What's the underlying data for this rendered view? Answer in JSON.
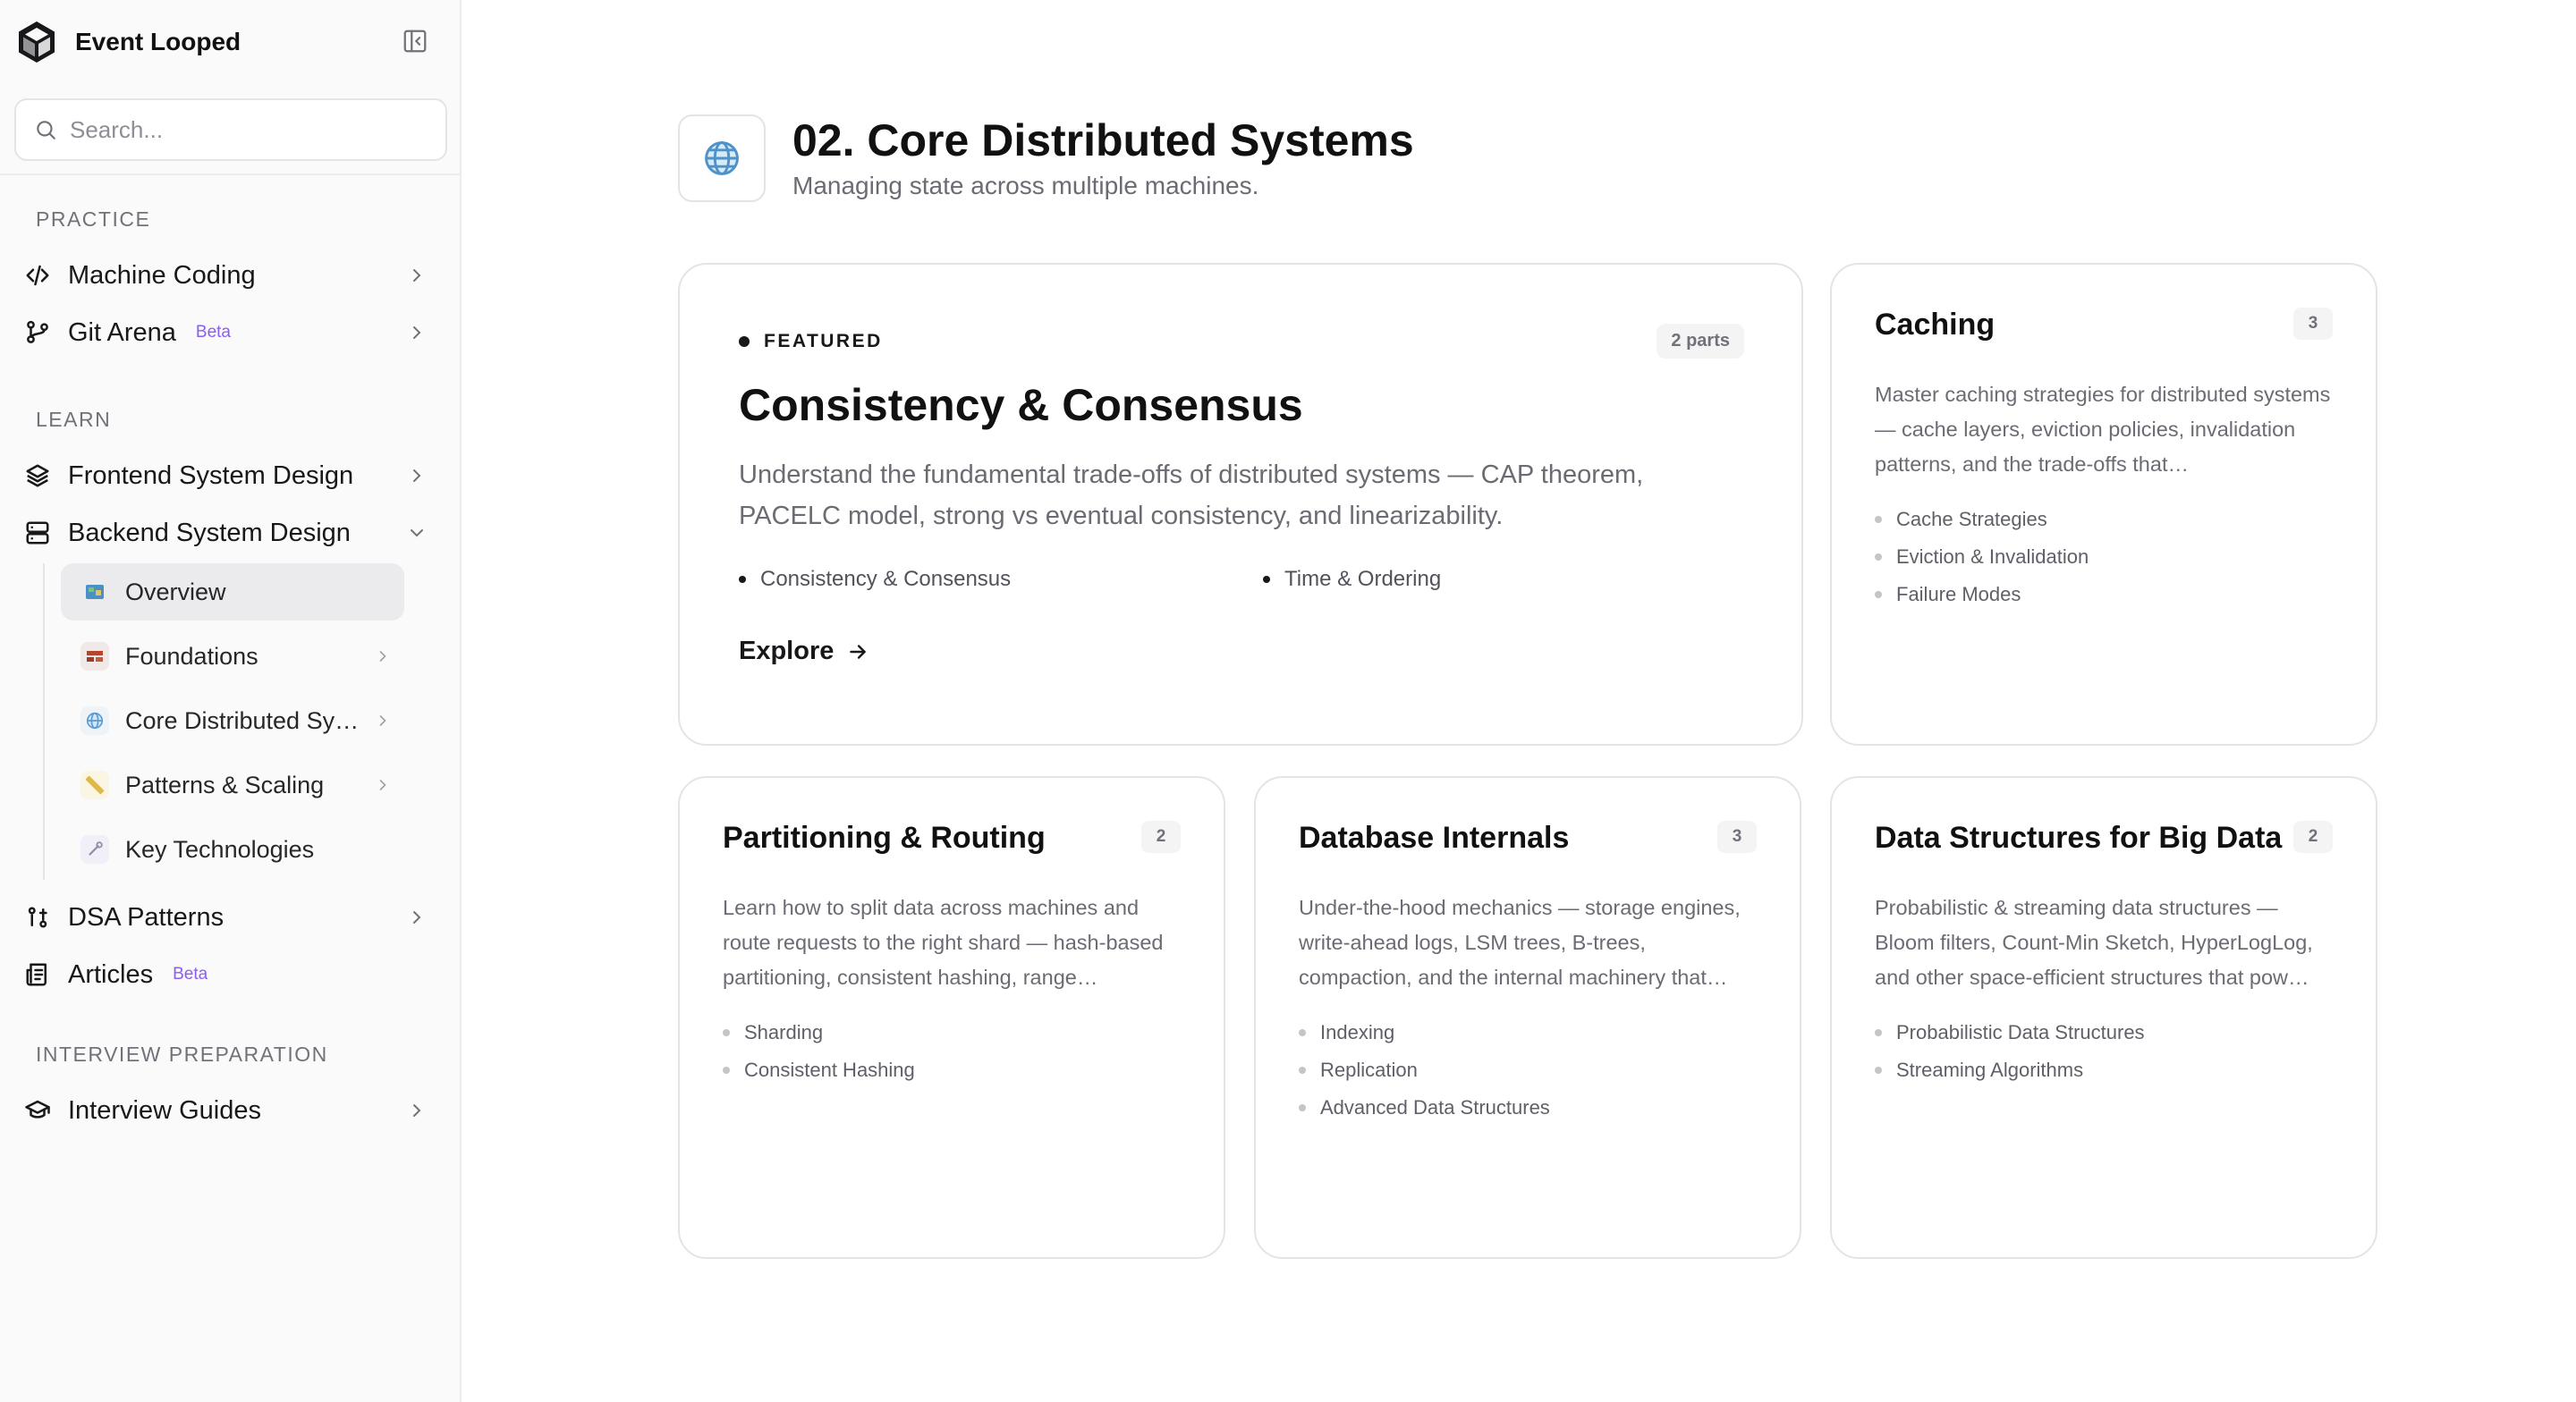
{
  "app": {
    "name": "Event Looped"
  },
  "search": {
    "placeholder": "Search..."
  },
  "sidebar": {
    "practice_label": "PRACTICE",
    "learn_label": "LEARN",
    "interview_label": "INTERVIEW PREPARATION",
    "practice": [
      {
        "label": "Machine Coding",
        "icon": "code-icon"
      },
      {
        "label": "Git Arena",
        "badge": "Beta",
        "icon": "git-branch-icon"
      }
    ],
    "learn": [
      {
        "label": "Frontend System Design",
        "icon": "layers-icon"
      },
      {
        "label": "Backend System Design",
        "icon": "server-icon"
      }
    ],
    "backend_sub": [
      {
        "label": "Overview",
        "icon": "map-emoji"
      },
      {
        "label": "Foundations",
        "icon": "brick-emoji"
      },
      {
        "label": "Core Distributed Sy…",
        "icon": "globe-emoji"
      },
      {
        "label": "Patterns & Scaling",
        "icon": "ruler-emoji"
      },
      {
        "label": "Key Technologies",
        "icon": "wrench-emoji"
      }
    ],
    "more": [
      {
        "label": "DSA Patterns",
        "icon": "dsa-icon"
      },
      {
        "label": "Articles",
        "badge": "Beta",
        "icon": "articles-icon"
      }
    ],
    "interview": [
      {
        "label": "Interview Guides",
        "icon": "graduation-cap-icon"
      }
    ]
  },
  "page": {
    "title": "02. Core Distributed Systems",
    "subtitle": "Managing state across multiple machines.",
    "icon": "globe-emoji"
  },
  "featured": {
    "tag": "FEATURED",
    "parts": "2 parts",
    "title": "Consistency & Consensus",
    "description": "Understand the fundamental trade-offs of distributed systems — CAP theorem, PACELC model, strong vs eventual consistency, and linearizability.",
    "topics": [
      "Consistency & Consensus",
      "Time & Ordering"
    ],
    "cta": "Explore"
  },
  "cards": [
    {
      "title": "Caching",
      "count": "3",
      "description": "Master caching strategies for distributed systems — cache layers, eviction policies, invalidation patterns, and the trade-offs that…",
      "topics": [
        "Cache Strategies",
        "Eviction & Invalidation",
        "Failure Modes"
      ]
    },
    {
      "title": "Partitioning & Routing",
      "count": "2",
      "description": "Learn how to split data across machines and route requests to the right shard — hash-based partitioning, consistent hashing, range…",
      "topics": [
        "Sharding",
        "Consistent Hashing"
      ]
    },
    {
      "title": "Database Internals",
      "count": "3",
      "description": "Under-the-hood mechanics — storage engines, write-ahead logs, LSM trees, B-trees, compaction, and the internal machinery that…",
      "topics": [
        "Indexing",
        "Replication",
        "Advanced Data Structures"
      ]
    },
    {
      "title": "Data Structures for Big Data",
      "count": "2",
      "description": "Probabilistic & streaming data structures — Bloom filters, Count-Min Sketch, HyperLogLog, and other space-efficient structures that pow…",
      "topics": [
        "Probabilistic Data Structures",
        "Streaming Algorithms"
      ]
    }
  ]
}
